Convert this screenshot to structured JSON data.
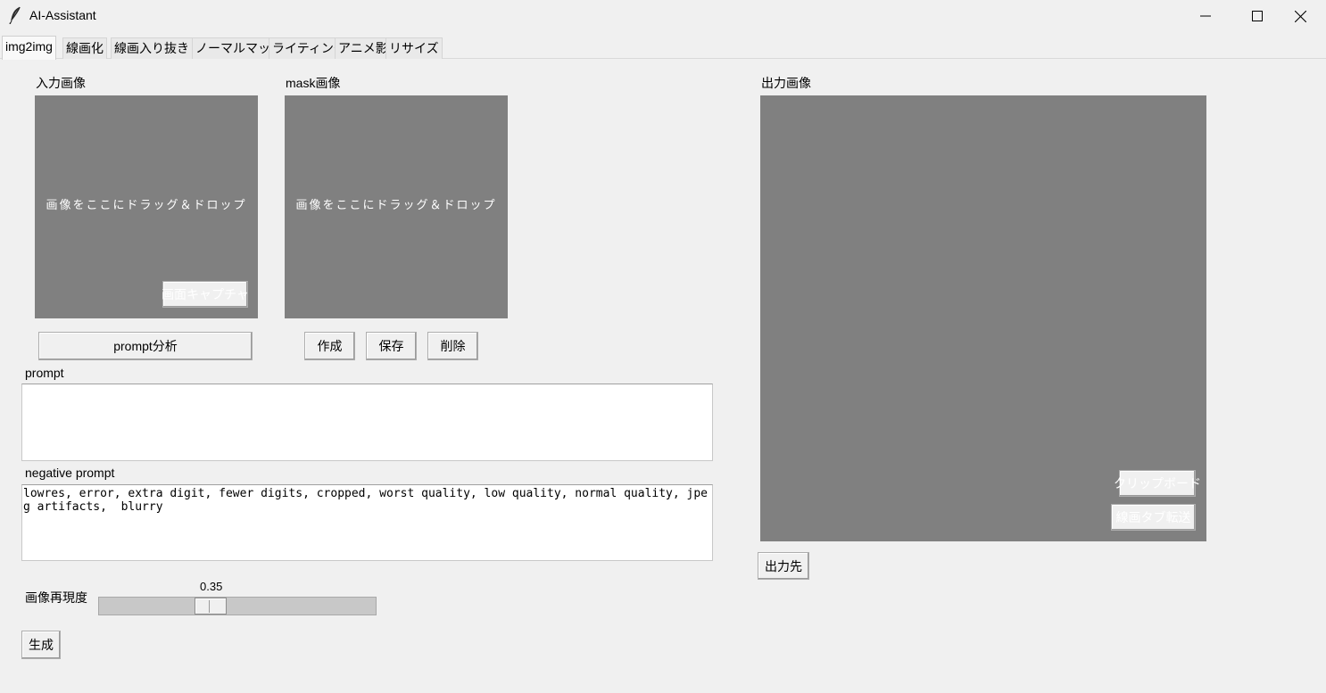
{
  "window": {
    "title": "AI-Assistant",
    "controls": {
      "minimize": "minimize-icon",
      "maximize": "maximize-icon",
      "close": "close-icon"
    }
  },
  "tabs": [
    {
      "label": "img2img",
      "active": true
    },
    {
      "label": "線画化"
    },
    {
      "label": "線画入り抜き"
    },
    {
      "label": "ノーマルマップ"
    },
    {
      "label": "ライティング"
    },
    {
      "label": "アニメ影"
    },
    {
      "label": "リサイズ"
    }
  ],
  "input_image": {
    "label": "入力画像",
    "drop_text": "画像をここにドラッグ＆ドロップ",
    "capture_button": "画面キャプチャ"
  },
  "mask_image": {
    "label": "mask画像",
    "drop_text": "画像をここにドラッグ＆ドロップ",
    "create_button": "作成",
    "save_button": "保存",
    "delete_button": "削除"
  },
  "prompt_analyze_button": "prompt分析",
  "prompt": {
    "label": "prompt",
    "value": ""
  },
  "negative_prompt": {
    "label": "negative prompt",
    "value": "lowres, error, extra digit, fewer digits, cropped, worst quality, low quality, normal quality, jpeg artifacts,  blurry"
  },
  "fidelity": {
    "label": "画像再現度",
    "value": "0.35",
    "min": 0,
    "max": 1
  },
  "generate_button": "生成",
  "output_image": {
    "label": "出力画像",
    "clipboard_button": "クリップボード",
    "transfer_button": "線画タブ転送",
    "destination_button": "出力先"
  },
  "colors": {
    "drop_area": "#808080",
    "background": "#f0f0f0"
  }
}
